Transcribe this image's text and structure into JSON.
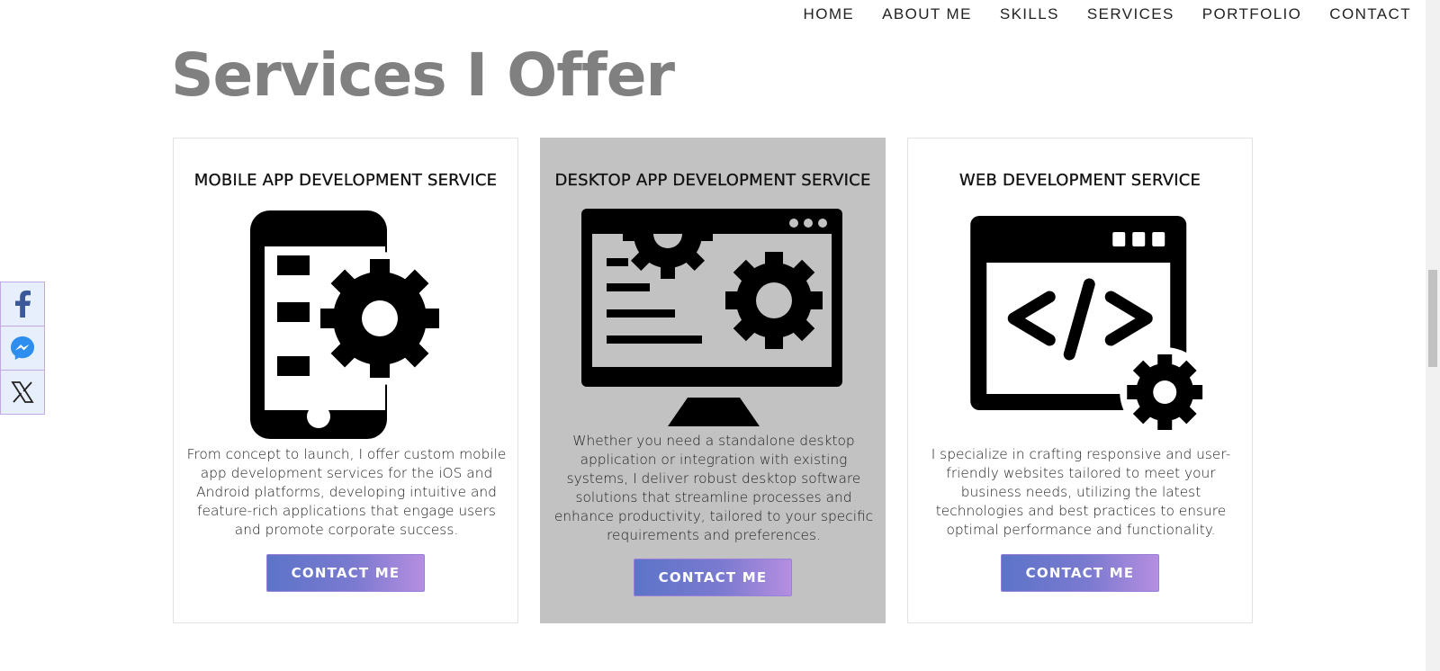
{
  "nav": {
    "items": [
      "HOME",
      "ABOUT ME",
      "SKILLS",
      "SERVICES",
      "PORTFOLIO",
      "CONTACT"
    ]
  },
  "page_title": "Services I Offer",
  "services": [
    {
      "title": "MOBILE APP DEVELOPMENT SERVICE",
      "icon": "mobile-gear-icon",
      "description": "From concept to launch, I offer custom mobile app development services for the iOS and Android platforms, developing intuitive and feature-rich applications that engage users and promote corporate success.",
      "button": "CONTACT ME"
    },
    {
      "title": "DESKTOP APP DEVELOPMENT SERVICE",
      "icon": "desktop-gear-icon",
      "description": "Whether you need a standalone desktop application or integration with existing systems, I deliver robust desktop software solutions that streamline processes and enhance productivity, tailored to your specific requirements and preferences.",
      "button": "CONTACT ME"
    },
    {
      "title": "WEB DEVELOPMENT SERVICE",
      "icon": "web-code-gear-icon",
      "description": "I specialize in crafting responsive and user-friendly websites tailored to meet your business needs, utilizing the latest technologies and best practices to ensure optimal performance and functionality.",
      "button": "CONTACT ME"
    }
  ],
  "social": {
    "items": [
      "facebook-icon",
      "messenger-icon",
      "x-icon"
    ]
  },
  "colors": {
    "title_gray": "#808080",
    "active_card": "#c2c2c2",
    "button_start": "#5c74c8",
    "button_end": "#b58ee0",
    "social_bg": "#e6effb",
    "facebook": "#3b5998",
    "messenger": "#2d8ef0"
  }
}
